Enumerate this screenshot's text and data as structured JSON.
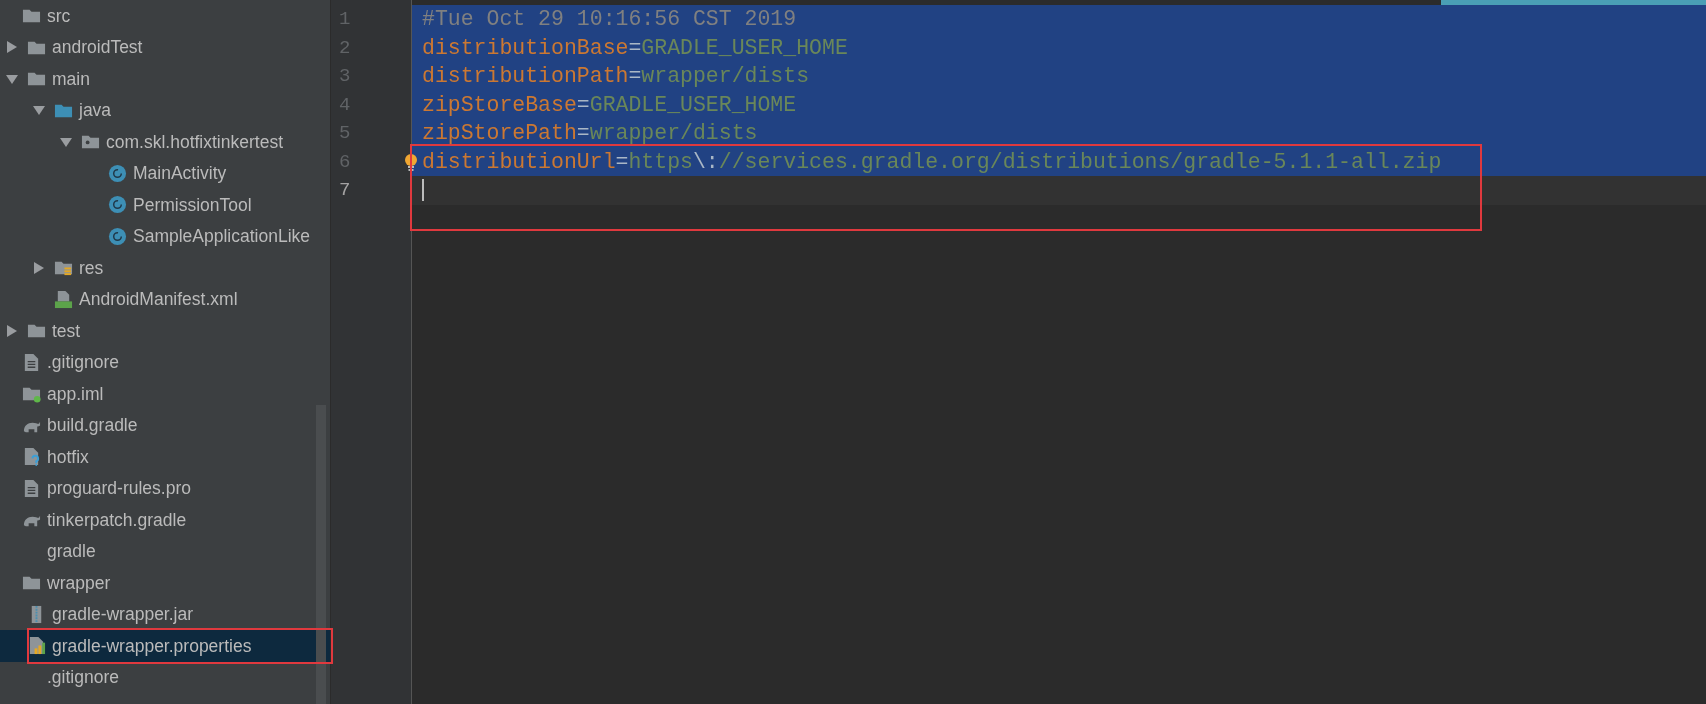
{
  "tree": [
    {
      "children": [
        {
          "label": "src",
          "kind": "folder",
          "children": [
            {
              "label": "androidTest",
              "kind": "folder",
              "expanded": false
            },
            {
              "label": "main",
              "kind": "folder",
              "expanded": true,
              "children": [
                {
                  "label": "java",
                  "kind": "source-folder",
                  "expanded": true,
                  "children": [
                    {
                      "label": "com.skl.hotfixtinkertest",
                      "kind": "package",
                      "expanded": true,
                      "children": [
                        {
                          "label": "MainActivity",
                          "kind": "class"
                        },
                        {
                          "label": "PermissionTool",
                          "kind": "class"
                        },
                        {
                          "label": "SampleApplicationLike",
                          "kind": "class"
                        }
                      ]
                    }
                  ]
                },
                {
                  "label": "res",
                  "kind": "res-folder",
                  "expanded": false
                },
                {
                  "label": "AndroidManifest.xml",
                  "kind": "manifest"
                }
              ]
            },
            {
              "label": "test",
              "kind": "folder",
              "expanded": false
            }
          ]
        },
        {
          "label": ".gitignore",
          "kind": "text-file"
        },
        {
          "label": "app.iml",
          "kind": "module-file"
        },
        {
          "label": "build.gradle",
          "kind": "gradle"
        },
        {
          "label": "hotfix",
          "kind": "unknown-file"
        },
        {
          "label": "proguard-rules.pro",
          "kind": "text-file"
        },
        {
          "label": "tinkerpatch.gradle",
          "kind": "gradle"
        }
      ]
    },
    {
      "label": "gradle",
      "children": [
        {
          "label": "wrapper",
          "kind": "folder",
          "children": [
            {
              "label": "gradle-wrapper.jar",
              "kind": "jar",
              "selected": false
            },
            {
              "label": "gradle-wrapper.properties",
              "kind": "properties",
              "selected": true,
              "annotated": true
            }
          ]
        }
      ]
    },
    {
      "label": ".gitignore"
    }
  ],
  "editor": {
    "lines": [
      {
        "number": "1",
        "selected": true,
        "current": false,
        "annotated": false,
        "tokens": [
          {
            "kind": "comment",
            "text": "#Tue Oct 29 10:16:56 CST 2019"
          }
        ]
      },
      {
        "number": "2",
        "selected": true,
        "current": false,
        "annotated": false,
        "tokens": [
          {
            "kind": "key",
            "text": "distributionBase"
          },
          {
            "kind": "sep",
            "text": "="
          },
          {
            "kind": "value",
            "text": "GRADLE_USER_HOME"
          }
        ]
      },
      {
        "number": "3",
        "selected": true,
        "current": false,
        "annotated": false,
        "tokens": [
          {
            "kind": "key",
            "text": "distributionPath"
          },
          {
            "kind": "sep",
            "text": "="
          },
          {
            "kind": "value",
            "text": "wrapper/dists"
          }
        ]
      },
      {
        "number": "4",
        "selected": true,
        "current": false,
        "annotated": false,
        "tokens": [
          {
            "kind": "key",
            "text": "zipStoreBase"
          },
          {
            "kind": "sep",
            "text": "="
          },
          {
            "kind": "value",
            "text": "GRADLE_USER_HOME"
          }
        ]
      },
      {
        "number": "5",
        "selected": true,
        "current": false,
        "annotated": false,
        "tokens": [
          {
            "kind": "key",
            "text": "zipStorePath"
          },
          {
            "kind": "sep",
            "text": "="
          },
          {
            "kind": "value",
            "text": "wrapper/dists"
          }
        ]
      },
      {
        "number": "6",
        "selected": true,
        "current": false,
        "annotated": true,
        "bulb": true,
        "tokens": [
          {
            "kind": "key",
            "text": "distributionUrl"
          },
          {
            "kind": "sep",
            "text": "="
          },
          {
            "kind": "value",
            "text": "https"
          },
          {
            "kind": "escape",
            "text": "\\:"
          },
          {
            "kind": "value",
            "text": "//services.gradle.org/distributions/gradle-5.1.1-all.zip"
          }
        ]
      },
      {
        "number": "7",
        "selected": false,
        "current": true,
        "annotated": true
      }
    ]
  }
}
